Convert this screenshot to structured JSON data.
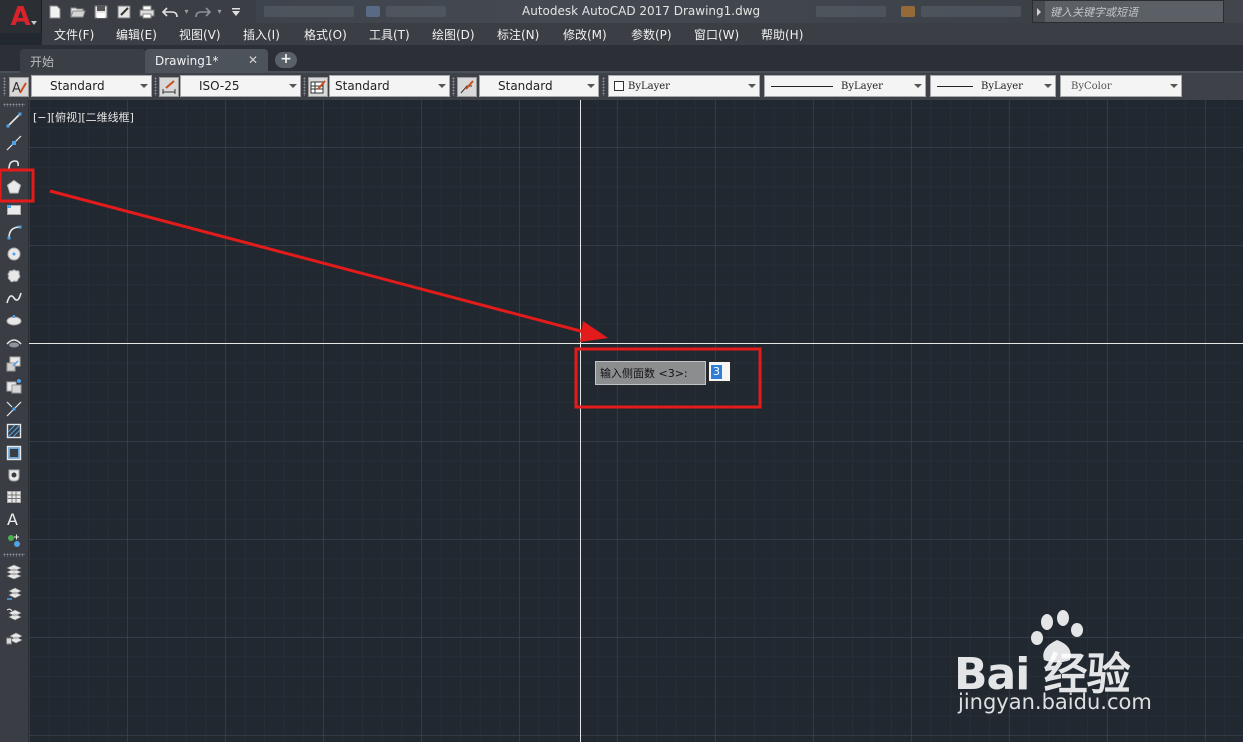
{
  "app": {
    "title": "Autodesk AutoCAD 2017    Drawing1.dwg",
    "logo_letter": "A",
    "search_placeholder": "键入关键字或短语"
  },
  "menu": {
    "items": [
      "文件(F)",
      "编辑(E)",
      "视图(V)",
      "插入(I)",
      "格式(O)",
      "工具(T)",
      "绘图(D)",
      "标注(N)",
      "修改(M)",
      "参数(P)",
      "窗口(W)",
      "帮助(H)"
    ]
  },
  "tabs": {
    "start_label": "开始",
    "drawing_label": "Drawing1*",
    "close_glyph": "✕",
    "add_glyph": "+"
  },
  "toolbar": {
    "text_style": "Standard",
    "dim_style": "ISO-25",
    "table_style": "Standard",
    "mleader_style": "Standard",
    "color": "ByLayer",
    "linetype": "ByLayer",
    "lineweight": "ByLayer",
    "plot_style": "ByColor"
  },
  "canvas": {
    "viewport_label": "[−][俯视][二维线框]",
    "background_color": "#212830"
  },
  "prompt": {
    "label": "输入侧面数 <3>:",
    "value": "3"
  },
  "annotation": {
    "color": "#e31b1b"
  },
  "watermark": {
    "brand": "Bai  经验",
    "url": "jingyan.baidu.com"
  },
  "left_toolbar": {
    "icons": [
      "line-icon",
      "construction-line-icon",
      "polyline-icon",
      "polygon-icon",
      "rectangle-icon",
      "arc-icon",
      "circle-icon",
      "revision-cloud-icon",
      "spline-icon",
      "ellipse-icon",
      "ellipse-arc-icon",
      "insert-block-icon",
      "make-block-icon",
      "point-icon",
      "hatch-icon",
      "gradient-icon",
      "region-icon",
      "table-icon",
      "multiline-text-icon",
      "add-selected-icon",
      "layer-icon",
      "layer-previous-icon",
      "layer-states-icon",
      "layer-properties-icon"
    ]
  }
}
